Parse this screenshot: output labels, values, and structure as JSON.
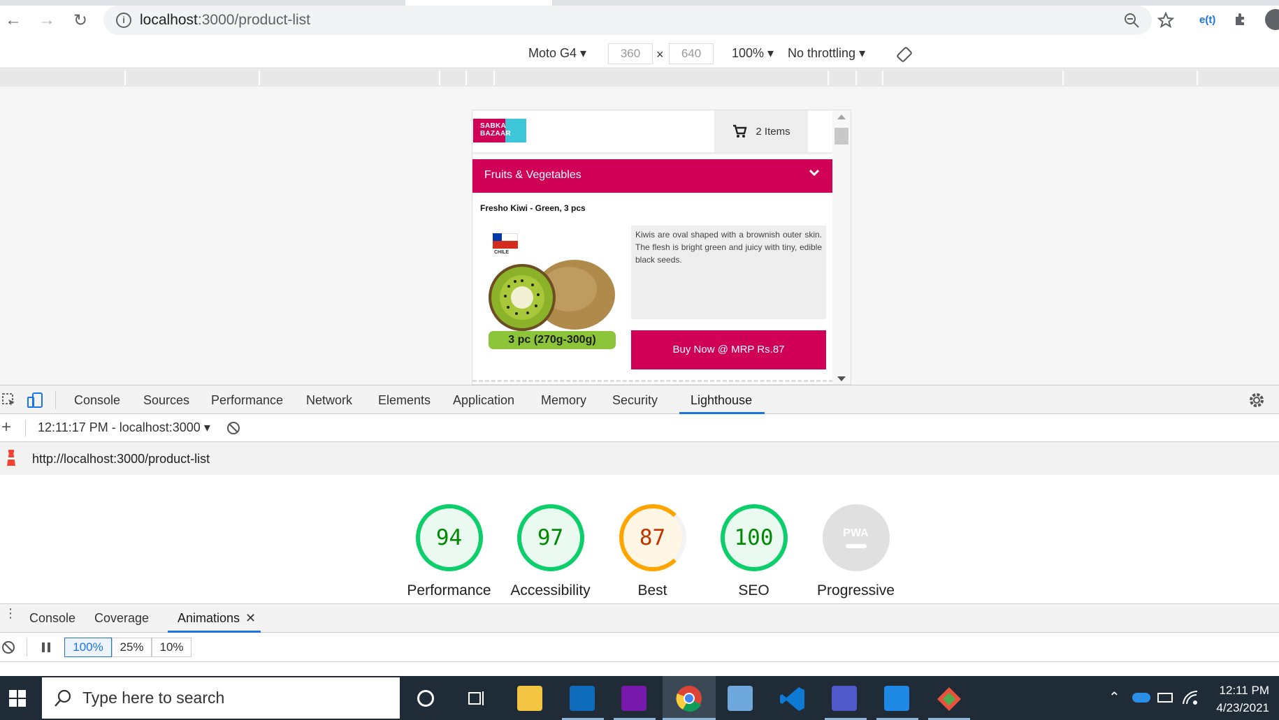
{
  "browser": {
    "url_host": "localhost",
    "url_rest": ":3000/product-list",
    "profile_badge": "e(t)"
  },
  "device_toolbar": {
    "device": "Moto G4",
    "width": "360",
    "height": "640",
    "times": "×",
    "zoom": "100%",
    "throttling": "No throttling"
  },
  "app": {
    "logo_line1": "SABKA",
    "logo_line2": "BAZAAR",
    "cart_label": "2 Items",
    "category": "Fruits & Vegetables",
    "product_name": "Fresho Kiwi - Green, 3 pcs",
    "flag_label": "CHILE",
    "pack_label": "3 pc (270g-300g)",
    "description": "Kiwis are oval shaped with a brownish outer skin. The flesh is bright green and juicy with tiny, edible black seeds.",
    "buy_label": "Buy Now @ MRP Rs.87",
    "brand_color": "#d10057"
  },
  "devtools": {
    "tabs": [
      "Console",
      "Sources",
      "Performance",
      "Network",
      "Elements",
      "Application",
      "Memory",
      "Security",
      "Lighthouse"
    ],
    "active_tab": "Lighthouse",
    "report_selector": "12:11:17 PM - localhost:3000",
    "report_url": "http://localhost:3000/product-list",
    "scores": [
      {
        "label": "Performance",
        "value": "94",
        "color": "#0cce6b",
        "fill": 0.94
      },
      {
        "label": "Accessibility",
        "value": "97",
        "color": "#0cce6b",
        "fill": 0.97
      },
      {
        "label": "Best",
        "value": "87",
        "color": "#ffa400",
        "fill": 0.87
      },
      {
        "label": "SEO",
        "value": "100",
        "color": "#0cce6b",
        "fill": 1.0
      },
      {
        "label": "Progressive",
        "value": "PWA",
        "color": "#cccccc",
        "fill": 0
      }
    ],
    "drawer_tabs": [
      "Console",
      "Coverage",
      "Animations"
    ],
    "active_drawer_tab": "Animations",
    "speeds": [
      "100%",
      "25%",
      "10%"
    ],
    "active_speed": "100%"
  },
  "taskbar": {
    "search_placeholder": "Type here to search",
    "time": "12:11 PM",
    "date": "4/23/2021"
  }
}
